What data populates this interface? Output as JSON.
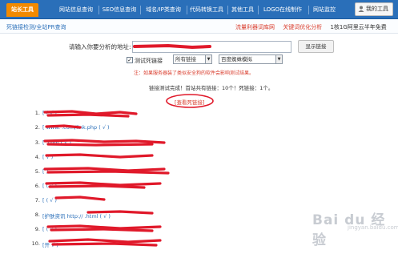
{
  "nav": {
    "tabs": [
      {
        "label": "站长工具",
        "active": true
      },
      {
        "label": "网站信息查询",
        "active": false
      },
      {
        "label": "SEO信息查询",
        "active": false
      },
      {
        "label": "域名/IP类查询",
        "active": false
      },
      {
        "label": "代码转换工具",
        "active": false
      },
      {
        "label": "其他工具",
        "active": false
      },
      {
        "label": "LOGO在线制作",
        "active": false
      },
      {
        "label": "网站监控",
        "active": false
      }
    ],
    "my_tools": "我的工具"
  },
  "subbar": {
    "breadcrumb": "死链接检测/全站PR查询",
    "link1": "流量利器词库网",
    "link2": "关键词优化分析",
    "link3": "1核1G阿里云半年免费"
  },
  "form": {
    "label": "请输入你要分析的地址:",
    "url_value": "",
    "query_button": "显示链接",
    "checkbox_label": "测试死链接",
    "checkbox_checked": true,
    "select_links": "所有链接",
    "select_spider": "百度蜘蛛模拟",
    "note": "注：如果服务器装了类似安全狗的软件会影响测试结果。"
  },
  "result": {
    "summary": "链接测试完成！首站共有链接：10个！死链接：1个。",
    "view_dead_button": "[查看死链接]"
  },
  "list": {
    "items": [
      {
        "num": "1.",
        "text": "[                              ( √ )"
      },
      {
        "num": "2.",
        "text": "[           www.         .com/link.php ( √ )"
      },
      {
        "num": "3.",
        "text": "[                     .com ( √ )"
      },
      {
        "num": "4.",
        "text": "[                       √ )"
      },
      {
        "num": "5.",
        "text": "[                             ]"
      },
      {
        "num": "6.",
        "text": "[                       ( √ )"
      },
      {
        "num": "7.",
        "text": "[           ( √ )"
      },
      {
        "num": "8.",
        "text": "[护肤资讯 http://                    .html ( √ )"
      },
      {
        "num": "9.",
        "text": "[                            ( √ )"
      },
      {
        "num": "10.",
        "text": "[开                              √ )"
      }
    ]
  },
  "watermark": {
    "brand": "Bai du 经验",
    "sub": "jingyan.baidu.com"
  },
  "colors": {
    "nav_bg": "#2a6fb9",
    "active_tab": "#f18a00",
    "redaction": "#e0192a",
    "link": "#2a6fb9"
  }
}
